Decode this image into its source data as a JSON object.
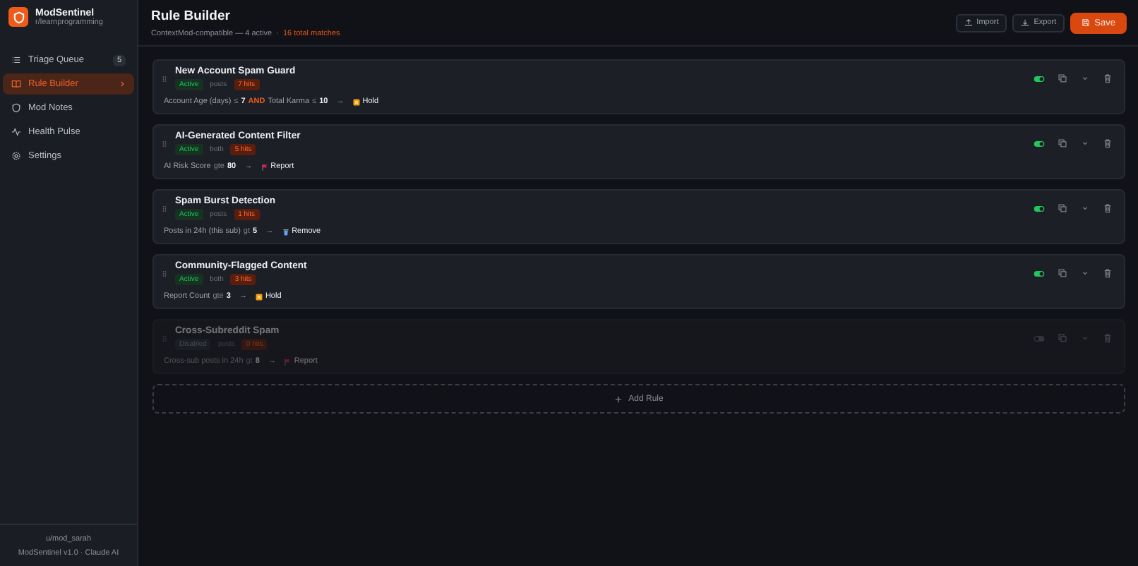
{
  "brand": {
    "name": "ModSentinel",
    "subreddit": "r/learnprogramming"
  },
  "nav": [
    {
      "label": "Triage Queue",
      "kind": "list",
      "badge": "5",
      "selected": false
    },
    {
      "label": "Rule Builder",
      "kind": "book",
      "selected": true
    },
    {
      "label": "Mod Notes",
      "kind": "shield",
      "selected": false
    },
    {
      "label": "Health Pulse",
      "kind": "pulse",
      "selected": false
    },
    {
      "label": "Settings",
      "kind": "gear",
      "selected": false
    }
  ],
  "footer": {
    "user": "u/mod_sarah",
    "version": "ModSentinel v1.0 · Claude AI"
  },
  "header": {
    "title": "Rule Builder",
    "subtitle": "ContextMod-compatible — 4 active",
    "separator": "·",
    "matches": "16 total matches"
  },
  "buttons": [
    {
      "label": "Import",
      "kind": "import"
    },
    {
      "label": "Export",
      "kind": "export"
    },
    {
      "label": "Save",
      "kind": "save"
    }
  ],
  "rules": [
    {
      "name": "New Account Spam Guard",
      "enabled": true,
      "status": "Active",
      "scope": "posts",
      "hits": "7 hits",
      "conditions": [
        {
          "field": "Account Age (days)",
          "op": "≤",
          "value": "7"
        },
        {
          "join": "AND",
          "field": "Total Karma",
          "op": "≤",
          "value": "10"
        }
      ],
      "arrow": "→",
      "action": {
        "kind": "hold",
        "label": "Hold"
      }
    },
    {
      "name": "AI-Generated Content Filter",
      "enabled": true,
      "status": "Active",
      "scope": "both",
      "hits": "5 hits",
      "conditions": [
        {
          "field": "AI Risk Score",
          "op": "gte",
          "value": "80"
        }
      ],
      "arrow": "→",
      "action": {
        "kind": "report",
        "label": "Report"
      }
    },
    {
      "name": "Spam Burst Detection",
      "enabled": true,
      "status": "Active",
      "scope": "posts",
      "hits": "1 hits",
      "conditions": [
        {
          "field": "Posts in 24h (this sub)",
          "op": "gt",
          "value": "5"
        }
      ],
      "arrow": "→",
      "action": {
        "kind": "remove",
        "label": "Remove"
      }
    },
    {
      "name": "Community-Flagged Content",
      "enabled": true,
      "status": "Active",
      "scope": "both",
      "hits": "3 hits",
      "conditions": [
        {
          "field": "Report Count",
          "op": "gte",
          "value": "3"
        }
      ],
      "arrow": "→",
      "action": {
        "kind": "hold",
        "label": "Hold"
      }
    },
    {
      "name": "Cross-Subreddit Spam",
      "enabled": false,
      "status": "Disabled",
      "scope": "posts",
      "hits": "0 hits",
      "conditions": [
        {
          "field": "Cross-sub posts in 24h",
          "op": "gt",
          "value": "8"
        }
      ],
      "arrow": "→",
      "action": {
        "kind": "report",
        "label": "Report"
      }
    }
  ],
  "add_rule": "Add Rule"
}
